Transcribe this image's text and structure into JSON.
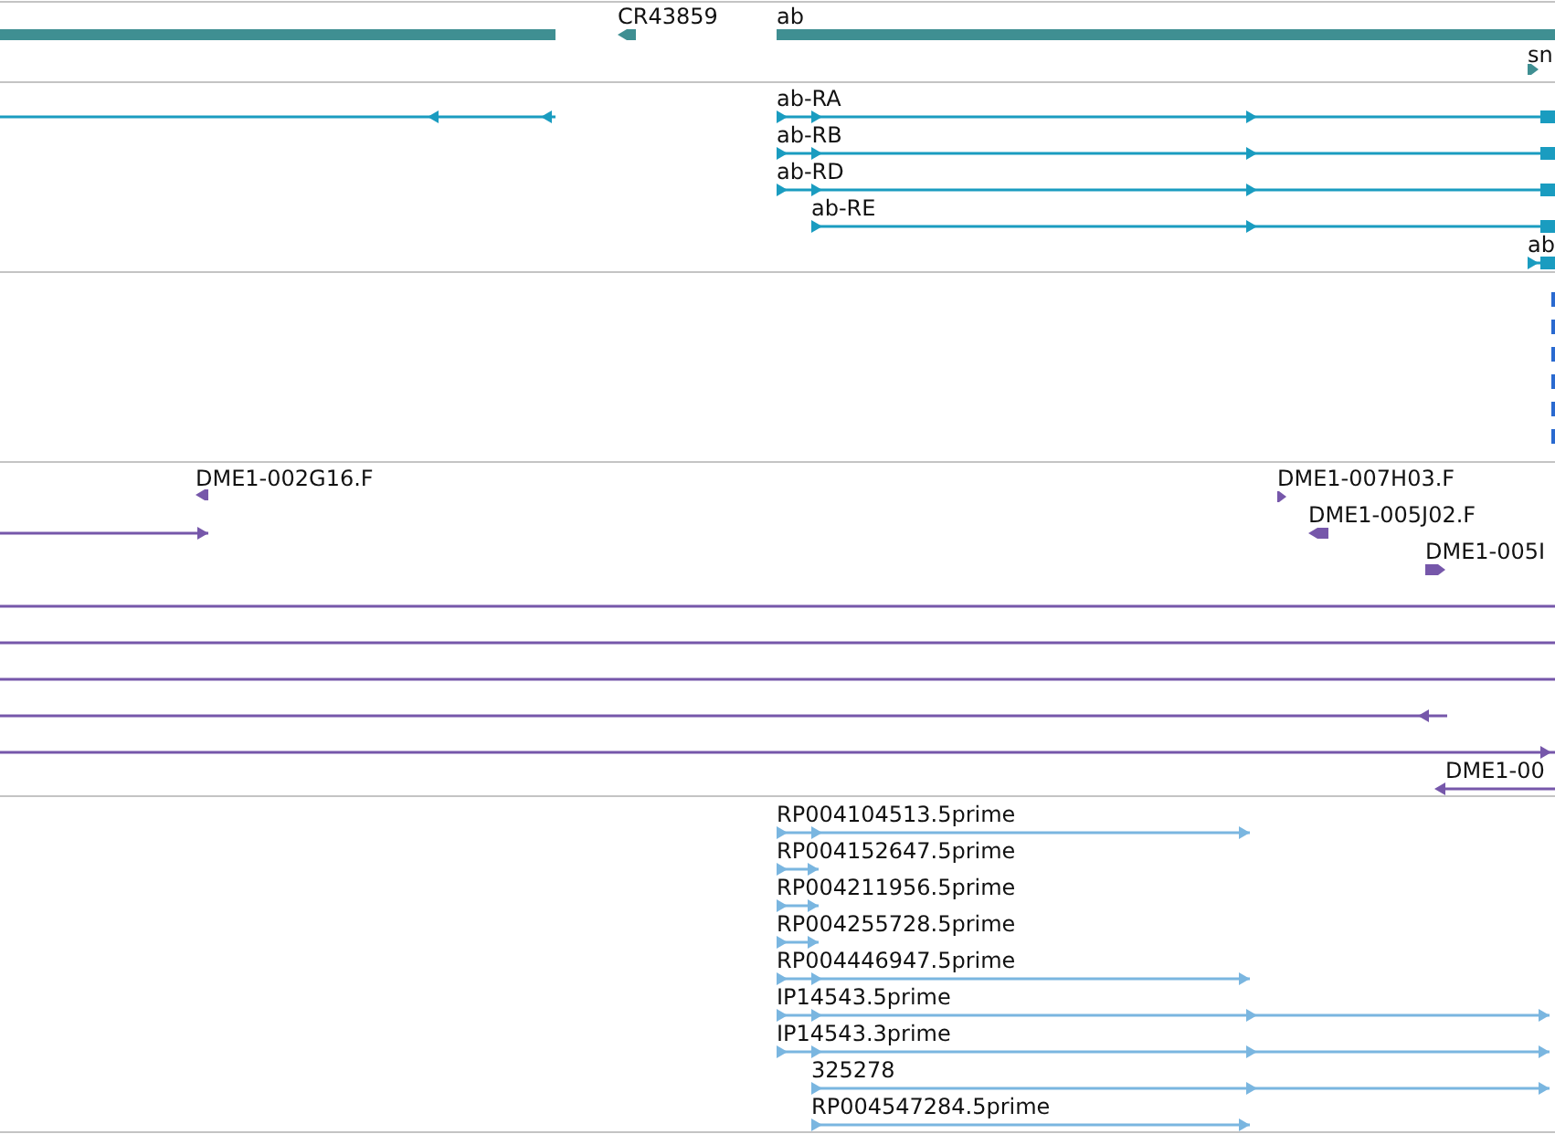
{
  "tracks": [
    {
      "kind": "gene",
      "features": [
        {
          "kind": "bar"
        },
        {
          "kind": "arrow",
          "label": "CR43859",
          "reverse": true
        },
        {
          "kind": "bar",
          "label": "ab"
        },
        {
          "kind": "arrow",
          "label": "sn",
          "reverse": false
        }
      ]
    },
    {
      "kind": "transcript",
      "features": [
        {
          "kind": "line",
          "reverse": true
        },
        {
          "kind": "line",
          "label": "ab-RA",
          "reverse": false
        },
        {
          "kind": "line",
          "label": "ab-RB",
          "reverse": false
        },
        {
          "kind": "line",
          "label": "ab-RD",
          "reverse": false
        },
        {
          "kind": "line",
          "label": "ab-RE",
          "reverse": false
        },
        {
          "kind": "line",
          "label": "ab",
          "reverse": false
        }
      ]
    },
    {
      "kind": "marks"
    },
    {
      "kind": "clone",
      "features": [
        {
          "kind": "arrow",
          "label": "DME1-002G16.F",
          "reverse": true
        },
        {
          "kind": "line",
          "reverse": false
        },
        {
          "kind": "arrow",
          "label": "DME1-007H03.F",
          "reverse": false
        },
        {
          "kind": "arrow",
          "label": "DME1-005J02.F",
          "reverse": true
        },
        {
          "kind": "arrow",
          "label": "DME1-005I",
          "reverse": false
        },
        {
          "kind": "line"
        },
        {
          "kind": "line"
        },
        {
          "kind": "line"
        },
        {
          "kind": "line",
          "reverse": true
        },
        {
          "kind": "line",
          "reverse": false
        },
        {
          "kind": "line",
          "label": "DME1-00",
          "reverse": true
        }
      ]
    },
    {
      "kind": "est",
      "features": [
        {
          "kind": "line",
          "label": "RP004104513.5prime",
          "reverse": false
        },
        {
          "kind": "line",
          "label": "RP004152647.5prime",
          "reverse": false
        },
        {
          "kind": "line",
          "label": "RP004211956.5prime",
          "reverse": false
        },
        {
          "kind": "line",
          "label": "RP004255728.5prime",
          "reverse": false
        },
        {
          "kind": "line",
          "label": "RP004446947.5prime",
          "reverse": false
        },
        {
          "kind": "line",
          "label": "IP14543.5prime",
          "reverse": false
        },
        {
          "kind": "line",
          "label": "IP14543.3prime",
          "reverse": false
        },
        {
          "kind": "line",
          "label": "325278",
          "reverse": false
        },
        {
          "kind": "line",
          "label": "RP004547284.5prime",
          "reverse": false
        }
      ]
    }
  ]
}
